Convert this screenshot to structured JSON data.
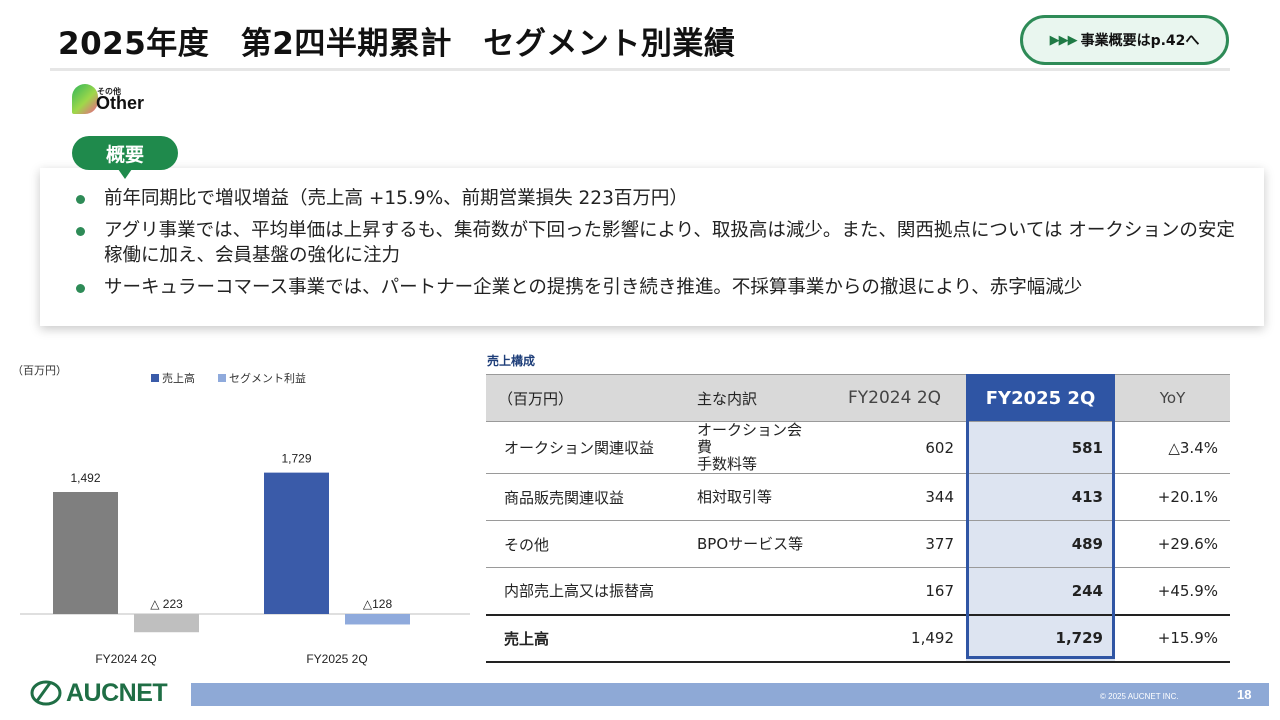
{
  "header": {
    "title": "2025年度　第2四半期累計　セグメント別業績",
    "ref_link": "事業概要はp.42へ",
    "ref_arrows": "▶▶▶"
  },
  "segment": {
    "logo_small": "その他",
    "logo_big": "Other"
  },
  "summary": {
    "badge": "概要",
    "bullets": [
      "前年同期比で増収増益（売上高 +15.9%、前期営業損失 223百万円）",
      "アグリ事業では、平均単価は上昇するも、集荷数が下回った影響により、取扱高は減少。また、関西拠点については オークションの安定稼働に加え、会員基盤の強化に注力",
      "サーキュラーコマース事業では、パートナー企業との提携を引き続き推進。不採算事業からの撤退により、赤字幅減少"
    ]
  },
  "chart_data": {
    "type": "bar",
    "unit_label": "（百万円）",
    "categories": [
      "FY2024 2Q",
      "FY2025 2Q"
    ],
    "series": [
      {
        "name": "売上高",
        "values": [
          1492,
          1729
        ],
        "labels": [
          "1,492",
          "1,729"
        ],
        "color": "#3a5ba9",
        "first_color": "#7f7f7f"
      },
      {
        "name": "セグメント利益",
        "values": [
          -223,
          -128
        ],
        "labels": [
          "△ 223",
          "△128"
        ],
        "color": "#8faadc",
        "first_color": "#bfbfbf"
      }
    ],
    "ylim": [
      -250,
      1900
    ],
    "grid": false,
    "legend": "top"
  },
  "table": {
    "title": "売上構成",
    "headers": [
      "（百万円）",
      "主な内訳",
      "FY2024 2Q",
      "FY2025 2Q",
      "YoY"
    ],
    "rows": [
      {
        "segment": "オークション関連収益",
        "desc": "オークション会費\n手数料等",
        "prev": "602",
        "cur": "581",
        "yoy": "△3.4%"
      },
      {
        "segment": "商品販売関連収益",
        "desc": "相対取引等",
        "prev": "344",
        "cur": "413",
        "yoy": "+20.1%"
      },
      {
        "segment": "その他",
        "desc": "BPOサービス等",
        "prev": "377",
        "cur": "489",
        "yoy": "+29.6%"
      },
      {
        "segment": "内部売上高又は振替高",
        "desc": "",
        "prev": "167",
        "cur": "244",
        "yoy": "+45.9%"
      }
    ],
    "total": {
      "segment": "売上高",
      "desc": "",
      "prev": "1,492",
      "cur": "1,729",
      "yoy": "+15.9%"
    }
  },
  "footer": {
    "company": "AUCNET",
    "copyright": "© 2025 AUCNET INC.",
    "page": "18"
  },
  "colors": {
    "accent_green": "#1f8a4c",
    "highlight_blue": "#2f55a4",
    "footer_bar": "#8ea9d6"
  }
}
